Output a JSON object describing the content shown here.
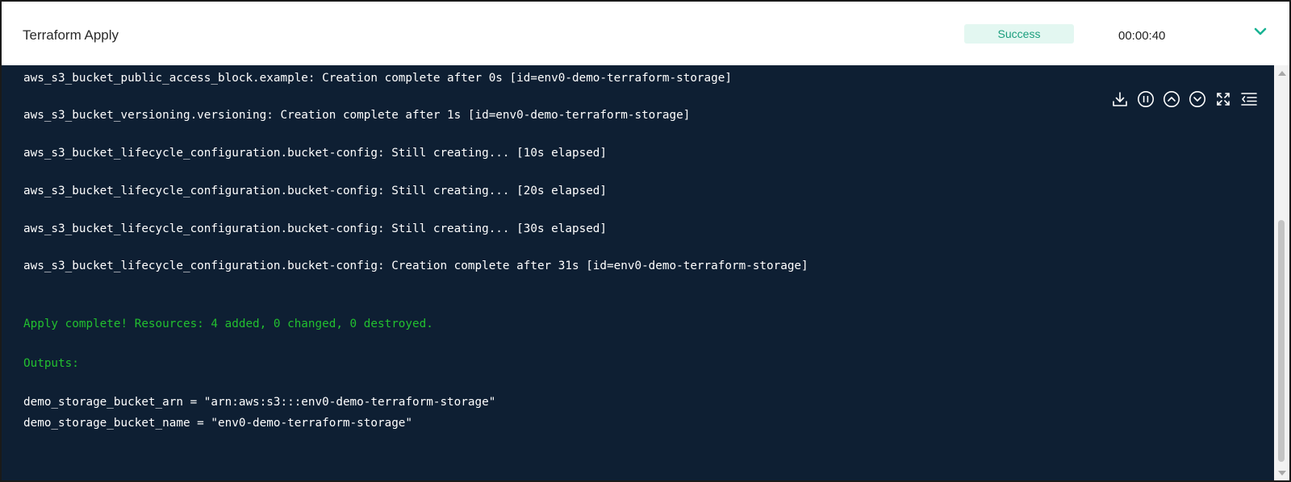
{
  "step": {
    "title": "Terraform Apply",
    "status": "Success",
    "duration": "00:00:40"
  },
  "toolbar": {
    "icons": [
      "download-icon",
      "pause-icon",
      "scroll-up-icon",
      "scroll-down-icon",
      "fullscreen-icon",
      "collapse-list-icon"
    ]
  },
  "log": {
    "lines": [
      "aws_s3_bucket_public_access_block.example: Creation complete after 0s [id=env0-demo-terraform-storage]",
      "aws_s3_bucket_versioning.versioning: Creation complete after 1s [id=env0-demo-terraform-storage]",
      "aws_s3_bucket_lifecycle_configuration.bucket-config: Still creating... [10s elapsed]",
      "aws_s3_bucket_lifecycle_configuration.bucket-config: Still creating... [20s elapsed]",
      "aws_s3_bucket_lifecycle_configuration.bucket-config: Still creating... [30s elapsed]",
      "aws_s3_bucket_lifecycle_configuration.bucket-config: Creation complete after 31s [id=env0-demo-terraform-storage]",
      "Apply complete! Resources: 4 added, 0 changed, 0 destroyed.",
      "Outputs:",
      "demo_storage_bucket_arn = \"arn:aws:s3:::env0-demo-terraform-storage\"",
      "demo_storage_bucket_name = \"env0-demo-terraform-storage\""
    ]
  },
  "colors": {
    "console_bg": "#0e1f33",
    "success_text": "#22c02f",
    "badge_bg": "#e3f7f1",
    "badge_text": "#1a9e7d",
    "accent": "#19b393"
  }
}
